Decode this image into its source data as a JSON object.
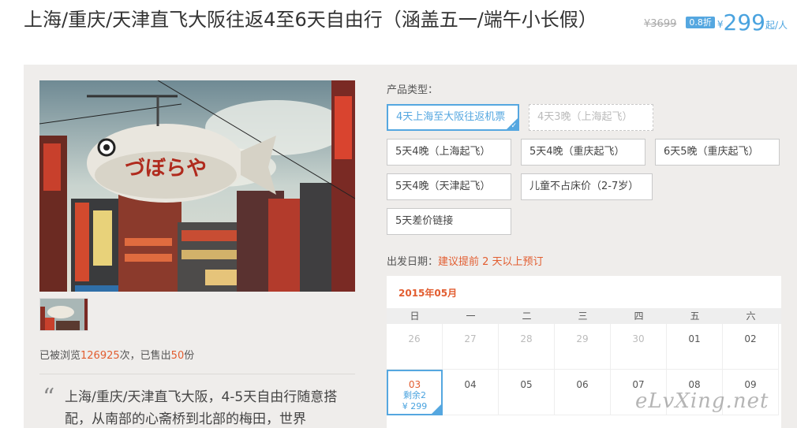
{
  "header": {
    "title": "上海/重庆/天津直飞大阪往返4至6天自由行（涵盖五一/端午小长假）",
    "original_price": "¥3699",
    "discount": "0.8折",
    "currency": "¥",
    "price": "299",
    "price_unit": "起/人"
  },
  "stats": {
    "viewed_prefix": "已被浏览",
    "viewed_count": "126925",
    "viewed_mid": "次，已售出",
    "sold_count": "50",
    "sold_suffix": "份"
  },
  "description": {
    "quote": "“",
    "text": "上海/重庆/天津直飞大阪，4-5天自由行随意搭配，从南部的心斋桥到北部的梅田，世界"
  },
  "product": {
    "label": "产品类型：",
    "options": [
      "4天上海至大阪往返机票",
      "4天3晚（上海起飞）",
      "5天4晚（上海起飞）",
      "5天4晚（重庆起飞）",
      "6天5晚（重庆起飞）",
      "5天4晚（天津起飞）",
      "儿童不占床价（2-7岁）",
      "5天差价链接"
    ]
  },
  "departure": {
    "label": "出发日期：",
    "note": "建议提前 2 天以上预订"
  },
  "calendar": {
    "month": "2015年05月",
    "weekdays": [
      "日",
      "一",
      "二",
      "三",
      "四",
      "五",
      "六"
    ],
    "row1": [
      "26",
      "27",
      "28",
      "29",
      "30",
      "01",
      "02"
    ],
    "row2": [
      "03",
      "04",
      "05",
      "06",
      "07",
      "08",
      "09"
    ],
    "selected_remaining": "剩余2",
    "selected_price": "¥ 299"
  },
  "watermark": "eLvXing.net",
  "colors": {
    "accent": "#55a7e0",
    "highlight": "#e25d30",
    "panel": "#efedeb"
  }
}
